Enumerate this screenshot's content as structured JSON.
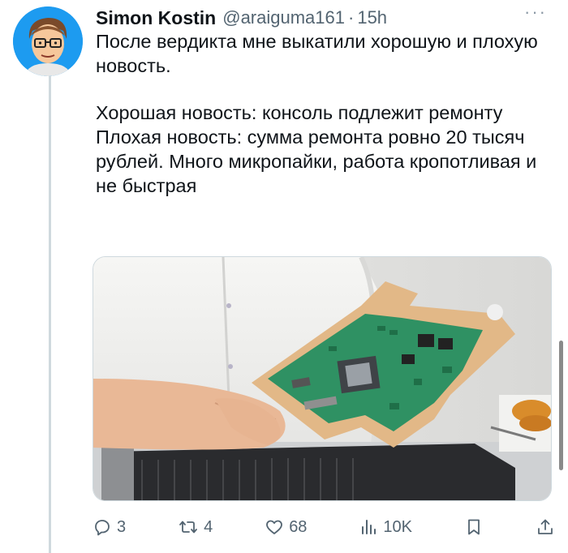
{
  "author": {
    "name": "Simon Kostin",
    "handle": "@araiguma161",
    "separator": "·",
    "time": "15h"
  },
  "more_menu": "···",
  "tweet": {
    "paragraph1": "После вердикта мне выкатили хорошую и плохую новость.",
    "line_good": "Хорошая новость: консоль подлежит ремонту",
    "line_bad": "Плохая новость: сумма ремонта ровно 20 тысяч рублей. Много микропайки, работа кропотливая и не быстрая"
  },
  "actions": {
    "replies": "3",
    "retweets": "4",
    "likes": "68",
    "views": "10K"
  },
  "icons": {
    "reply": "reply-icon",
    "retweet": "retweet-icon",
    "like": "heart-icon",
    "views": "views-bar-icon",
    "bookmark": "bookmark-icon",
    "share": "share-icon",
    "more": "more-icon"
  },
  "colors": {
    "text": "#0f1419",
    "secondary": "#536471",
    "avatar_bg": "#1d9bf0",
    "thread_line": "#cfd9de"
  }
}
